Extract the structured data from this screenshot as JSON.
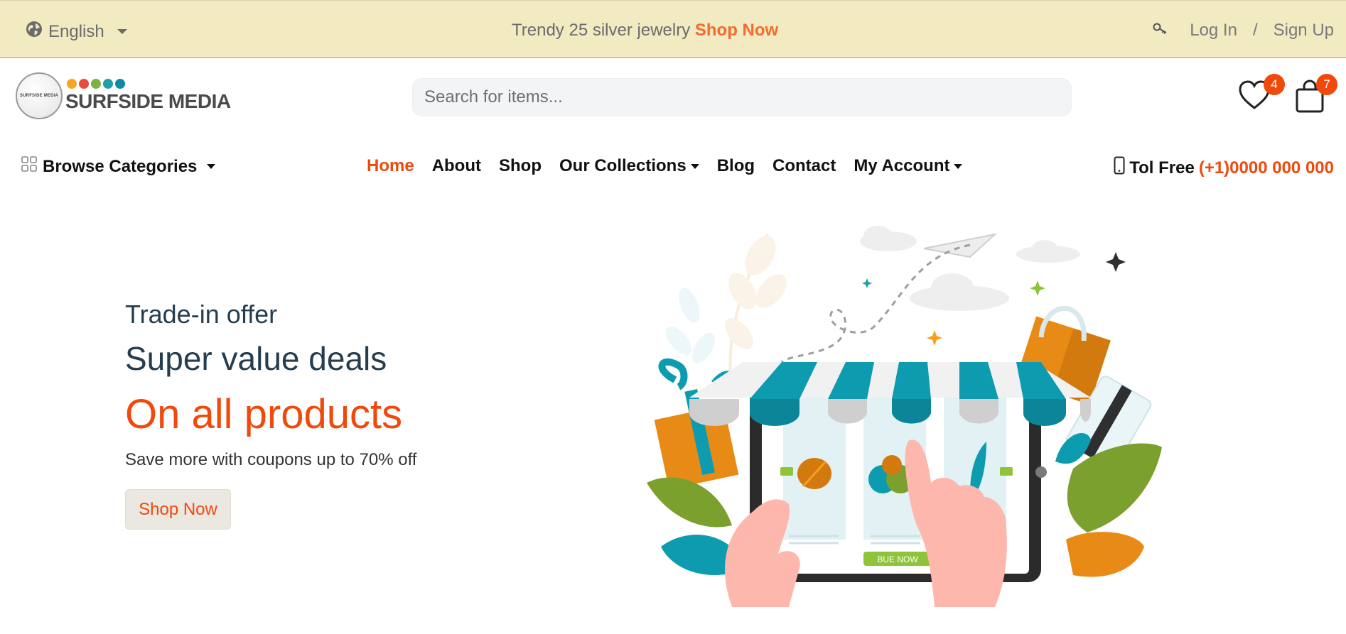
{
  "topbar": {
    "language": "English",
    "promo_text": "Trendy 25 silver jewelry",
    "promo_link": "Shop Now",
    "login": "Log In",
    "separator": "/",
    "signup": "Sign Up"
  },
  "header": {
    "logo_text": "SURFSIDE MEDIA",
    "logo_small_text": "SURFSIDE MEDIA",
    "logo_dot_colors": [
      "#f5a623",
      "#e84c3d",
      "#7cb342",
      "#1ea0a6",
      "#0d8aa5"
    ],
    "search_placeholder": "Search for items...",
    "wishlist_count": "4",
    "cart_count": "7"
  },
  "nav": {
    "browse": "Browse Categories",
    "items": [
      {
        "label": "Home",
        "active": true
      },
      {
        "label": "About"
      },
      {
        "label": "Shop"
      },
      {
        "label": "Our Collections",
        "dropdown": true
      },
      {
        "label": "Blog"
      },
      {
        "label": "Contact"
      },
      {
        "label": "My Account",
        "dropdown": true
      }
    ],
    "phone_label": "Tol Free",
    "phone_number": "(+1)0000 000 000"
  },
  "hero": {
    "subtitle": "Trade-in offer",
    "title": "Super value deals",
    "accent": "On all products",
    "description": "Save more with coupons up to 70% off",
    "button": "Shop Now",
    "illustration_button": "BUE NOW"
  },
  "colors": {
    "accent": "#f0490b",
    "topbar_bg": "#f2eac0",
    "teal": "#0d9bb0"
  }
}
